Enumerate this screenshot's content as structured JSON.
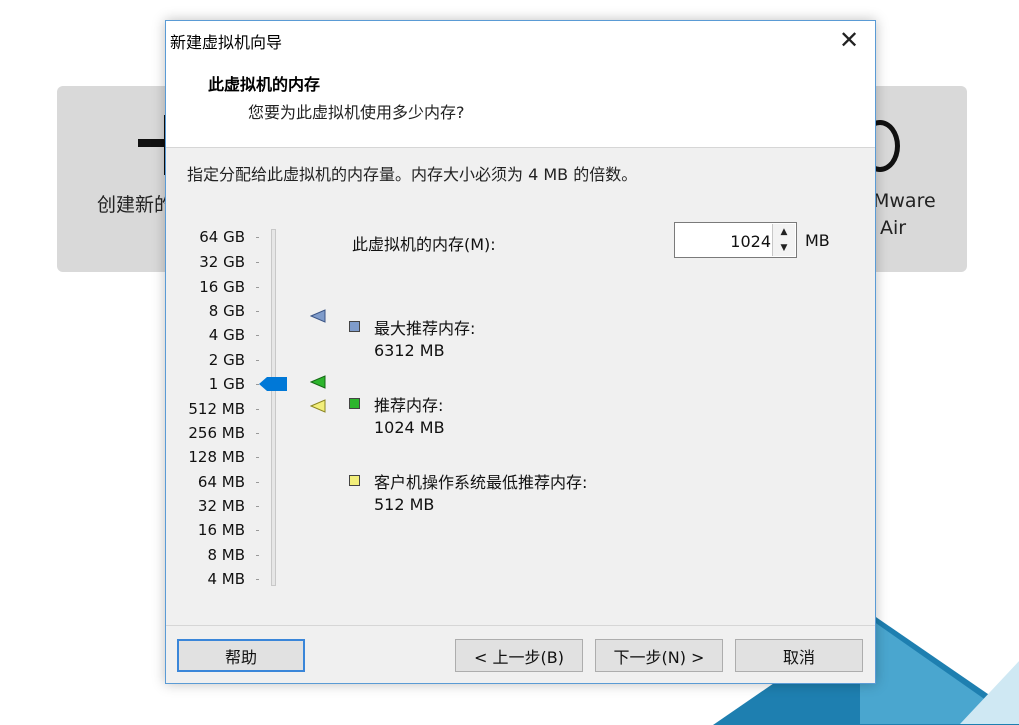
{
  "background": {
    "left_card_text": "创建新的",
    "right_card_line1": "Mware",
    "right_card_line2": "Air"
  },
  "dialog": {
    "title": "新建虚拟机向导",
    "header_title": "此虚拟机的内存",
    "header_subtitle": "您要为此虚拟机使用多少内存?",
    "instruction": "指定分配给此虚拟机的内存量。内存大小必须为 4 MB 的倍数。",
    "scale_labels": [
      "64 GB",
      "32 GB",
      "16 GB",
      "8 GB",
      "4 GB",
      "2 GB",
      "1 GB",
      "512 MB",
      "256 MB",
      "128 MB",
      "64 MB",
      "32 MB",
      "16 MB",
      "8 MB",
      "4 MB"
    ],
    "memory_label": "此虚拟机的内存(M):",
    "memory_value": "1024",
    "memory_unit": "MB",
    "legend": [
      {
        "label": "最大推荐内存:",
        "value": "6312 MB",
        "color": "#7f9ccb"
      },
      {
        "label": "推荐内存:",
        "value": "1024 MB",
        "color": "#2db52d"
      },
      {
        "label": "客户机操作系统最低推荐内存:",
        "value": "512 MB",
        "color": "#f2ee7a"
      }
    ],
    "buttons": {
      "help": "帮助",
      "back": "< 上一步(B)",
      "next": "下一步(N) >",
      "cancel": "取消"
    },
    "colors": {
      "accent": "#0078d7",
      "border": "#5a9bd5"
    }
  }
}
